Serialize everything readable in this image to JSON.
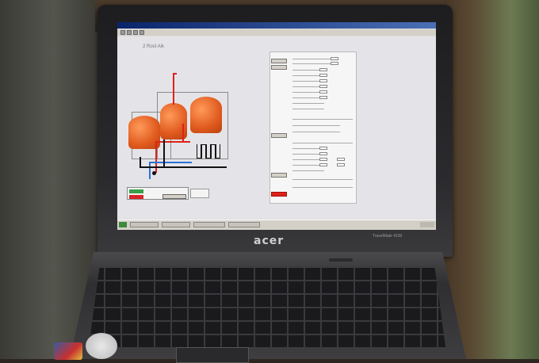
{
  "app": {
    "window_title": "",
    "section_title": "2 Rost Aik"
  },
  "laptop": {
    "brand": "acer",
    "model": "TravelMate 4100"
  },
  "colors": {
    "vessel": "#e05a1e",
    "pipe_hot": "#e0201a",
    "pipe_cold": "#2a72d8",
    "status_on": "#3aa04a",
    "status_off": "#d8242a"
  },
  "icons": {
    "start": "windows-start-icon"
  }
}
